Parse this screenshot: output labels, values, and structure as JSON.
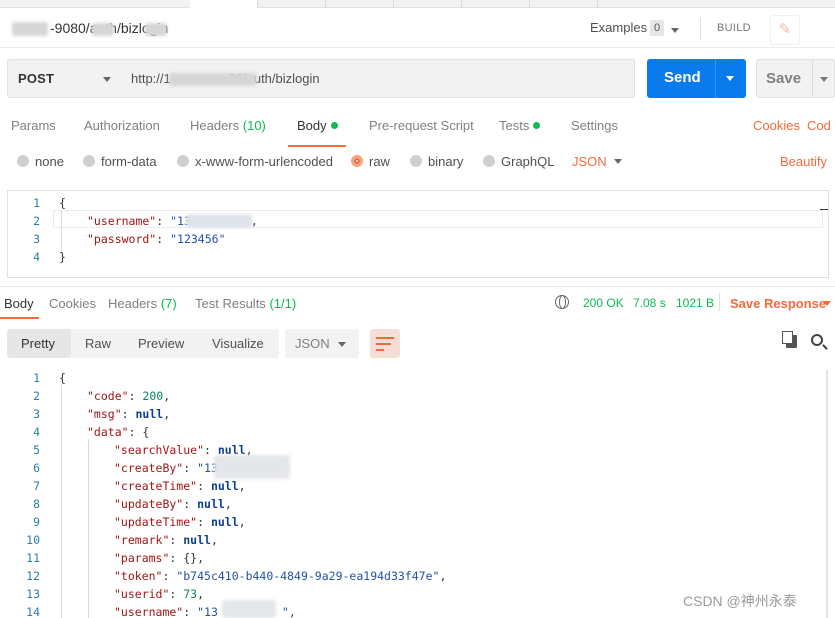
{
  "window": {
    "title": "-9080/auth/bizlogin",
    "title_prefix": "",
    "examples_label": "Examples",
    "examples_count": "0",
    "build_label": "BUILD",
    "edit_icon": "pencil-icon"
  },
  "request": {
    "method": "POST",
    "url": "http://1                80/auth/bizlogin",
    "send_label": "Send",
    "save_label": "Save"
  },
  "request_tabs": {
    "params": "Params",
    "authorization": "Authorization",
    "headers": "Headers",
    "headers_count": "(10)",
    "body": "Body",
    "prerequest": "Pre-request Script",
    "tests": "Tests",
    "settings": "Settings",
    "cookies": "Cookies",
    "code": "Cod"
  },
  "body_types": {
    "none": "none",
    "form_data": "form-data",
    "urlencoded": "x-www-form-urlencoded",
    "raw": "raw",
    "binary": "binary",
    "graphql": "GraphQL",
    "format": "JSON",
    "beautify": "Beautify"
  },
  "request_body": {
    "line_numbers": [
      "1",
      "2",
      "3",
      "4"
    ],
    "open": "{",
    "username_key": "\"username\"",
    "username_val": "\"13",
    "username_tail": ",",
    "password_key": "\"password\"",
    "password_val": "\"123456\"",
    "close": "}"
  },
  "response_tabs": {
    "body": "Body",
    "cookies": "Cookies",
    "headers": "Headers",
    "headers_count": "(7)",
    "test_results": "Test Results",
    "test_results_count": "(1/1)",
    "status": "200 OK",
    "time": "7.08 s",
    "size": "1021 B",
    "save_response": "Save Response"
  },
  "response_view": {
    "pretty": "Pretty",
    "raw": "Raw",
    "preview": "Preview",
    "visualize": "Visualize",
    "format": "JSON"
  },
  "response_body": {
    "line_numbers": [
      "1",
      "2",
      "3",
      "4",
      "5",
      "6",
      "7",
      "8",
      "9",
      "10",
      "11",
      "12",
      "13",
      "14"
    ],
    "l1": "{",
    "code_key": "\"code\"",
    "code_val": "200",
    "msg_key": "\"msg\"",
    "null": "null",
    "data_key": "\"data\"",
    "data_open": "{",
    "searchValue_key": "\"searchValue\"",
    "createBy_key": "\"createBy\"",
    "createBy_val": "\"134",
    "createTime_key": "\"createTime\"",
    "updateBy_key": "\"updateBy\"",
    "updateTime_key": "\"updateTime\"",
    "remark_key": "\"remark\"",
    "params_key": "\"params\"",
    "params_val": "{}",
    "token_key": "\"token\"",
    "token_val": "\"b745c410-b440-4849-9a29-ea194d33f47e\"",
    "userid_key": "\"userid\"",
    "userid_val": "73",
    "username_key": "\"username\"",
    "username_val": "\"13",
    "username_tail": "\","
  },
  "watermark": "CSDN @神州永泰"
}
